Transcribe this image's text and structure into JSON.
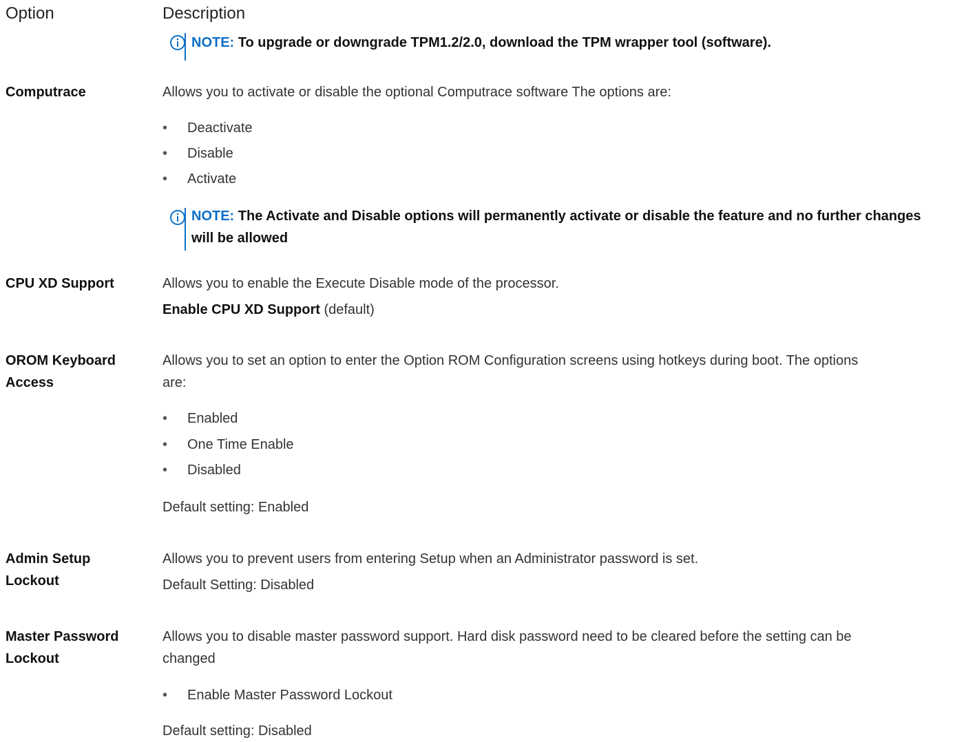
{
  "header": {
    "option": "Option",
    "description": "Description"
  },
  "note1": {
    "label": "NOTE:",
    "text": " To upgrade or downgrade TPM1.2/2.0, download the TPM wrapper tool (software)."
  },
  "computrace": {
    "name": "Computrace",
    "desc": "Allows you to activate or disable the optional Computrace software The options are:",
    "items": [
      "Deactivate",
      "Disable",
      "Activate"
    ],
    "note_label": "NOTE:",
    "note_text": " The Activate and Disable options will permanently activate or disable the feature and no further changes will be allowed"
  },
  "cpuxd": {
    "name": "CPU XD Support",
    "desc": "Allows you to enable the Execute Disable mode of the processor.",
    "enable_bold": "Enable CPU XD Support",
    "enable_suffix": " (default)"
  },
  "orom": {
    "name": "OROM Keyboard Access",
    "desc_line1": "Allows you to set an option to enter the Option ROM Configuration screens using hotkeys during boot. The options",
    "desc_line2": "are:",
    "items": [
      "Enabled",
      "One Time Enable",
      "Disabled"
    ],
    "default": "Default setting: Enabled"
  },
  "admin": {
    "name": "Admin Setup Lockout",
    "desc": "Allows you to prevent users from entering Setup when an Administrator password is set.",
    "default": "Default Setting: Disabled"
  },
  "master": {
    "name": "Master Password Lockout",
    "desc_line1": "Allows you to disable master password support. Hard disk password need to be cleared before the setting can be",
    "desc_line2": "changed",
    "items": [
      "Enable Master Password Lockout"
    ],
    "default": "Default setting: Disabled"
  },
  "icons": {
    "note": "info-icon"
  },
  "colors": {
    "note_accent": "#0b6fc7"
  }
}
